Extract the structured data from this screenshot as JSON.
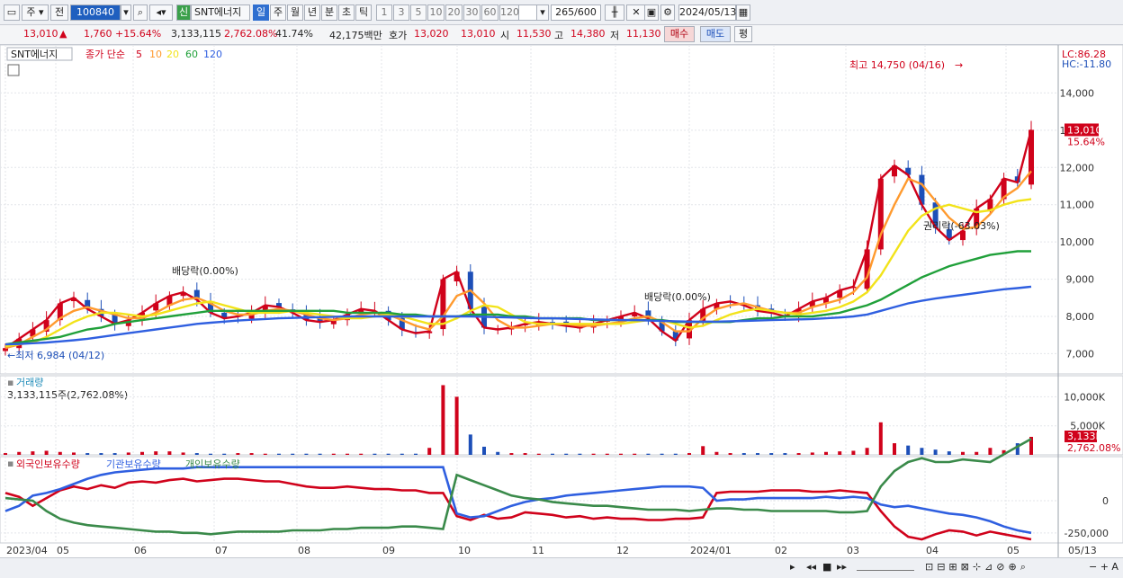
{
  "toolbar": {
    "type_label": "주",
    "prev_label": "전",
    "code": "100840",
    "badge": "신",
    "stock_name": "SNT에너지",
    "periods": [
      "일",
      "주",
      "월",
      "년",
      "분",
      "초",
      "틱"
    ],
    "active_period": "일",
    "intervals": [
      "1",
      "3",
      "5",
      "10",
      "20",
      "30",
      "60",
      "120"
    ],
    "count": "265",
    "count_max": "/600",
    "date": "2024/05/13"
  },
  "quote": {
    "price": "13,010",
    "change": "1,760",
    "change_pct": "+15.64%",
    "volume": "3,133,115",
    "volume_ratio": "2,762.08%",
    "turnover_rate": "41.74%",
    "amount": "42,175백만",
    "ask_label": "호가",
    "ask": "13,020",
    "bid": "13,010",
    "open_label": "시",
    "open": "11,530",
    "high_label": "고",
    "high": "14,380",
    "low_label": "저",
    "low": "11,130",
    "buy_label": "매수",
    "sell_label": "매도",
    "avg_label": "평"
  },
  "colors": {
    "up": "#d0021b",
    "down": "#1d4fb8",
    "ma5": "#d0021b",
    "ma10": "#ff9a2e",
    "ma20": "#f2e31a",
    "ma60": "#20a03a",
    "ma120": "#2f5fe0"
  },
  "chart_data": {
    "type": "line",
    "price": {
      "title": "SNT에너지",
      "legend": [
        "종가 단순",
        "5",
        "10",
        "20",
        "60",
        "120"
      ],
      "ylim": [
        6600,
        15000
      ],
      "y_ticks": [
        "7,000",
        "8,000",
        "9,000",
        "10,000",
        "11,000",
        "12,000",
        "13,000",
        "14,000"
      ],
      "y_tick_values": [
        7000,
        8000,
        9000,
        10000,
        11000,
        12000,
        13000,
        14000
      ],
      "x_ticks": [
        "2023/04",
        "05",
        "06",
        "07",
        "08",
        "09",
        "10",
        "11",
        "12",
        "2024/01",
        "02",
        "03",
        "04",
        "05",
        "05/13"
      ],
      "lc": "LC:86.28",
      "hc": "HC:-11.80",
      "last_price": "13,010",
      "last_pct": "15.64%",
      "annotations": {
        "high": "최고 14,750 (04/16)",
        "low": "최저 6,984 (04/12)",
        "div1": "배당락(0.00%)",
        "div2": "배당락(0.00%)",
        "rights": "권리락(-63.03%)"
      },
      "series": [
        {
          "name": "5",
          "values": [
            7150,
            7400,
            7650,
            7900,
            8350,
            8500,
            8200,
            8000,
            7800,
            7900,
            8100,
            8350,
            8550,
            8650,
            8450,
            8100,
            7950,
            8000,
            8100,
            8300,
            8250,
            8100,
            7900,
            7850,
            7900,
            8050,
            8200,
            8150,
            7900,
            7650,
            7550,
            7600,
            9000,
            9200,
            8200,
            7700,
            7650,
            7700,
            7800,
            7850,
            7800,
            7750,
            7700,
            7800,
            7900,
            8000,
            8100,
            7950,
            7600,
            7350,
            7900,
            8200,
            8350,
            8400,
            8300,
            8150,
            8100,
            8000,
            8200,
            8400,
            8500,
            8700,
            8800,
            9800,
            11700,
            12050,
            11800,
            11000,
            10400,
            10050,
            10300,
            10900,
            11150,
            11700,
            11600,
            13010
          ]
        },
        {
          "name": "10",
          "values": [
            7150,
            7250,
            7450,
            7650,
            7950,
            8150,
            8250,
            8150,
            8050,
            7950,
            7950,
            8100,
            8300,
            8450,
            8500,
            8350,
            8150,
            8050,
            8050,
            8150,
            8200,
            8150,
            8050,
            7950,
            7900,
            7950,
            8050,
            8100,
            8050,
            7900,
            7750,
            7650,
            8000,
            8550,
            8700,
            8350,
            7900,
            7700,
            7700,
            7750,
            7800,
            7800,
            7750,
            7750,
            7800,
            7850,
            7950,
            8000,
            7850,
            7600,
            7600,
            7950,
            8200,
            8300,
            8350,
            8250,
            8150,
            8100,
            8100,
            8250,
            8350,
            8450,
            8650,
            9050,
            10200,
            11000,
            11700,
            11550,
            11100,
            10650,
            10350,
            10400,
            10750,
            11200,
            11450,
            11900
          ]
        },
        {
          "name": "20",
          "values": [
            7200,
            7250,
            7300,
            7450,
            7650,
            7850,
            8000,
            8100,
            8100,
            8050,
            8000,
            8050,
            8150,
            8250,
            8350,
            8400,
            8300,
            8200,
            8100,
            8100,
            8100,
            8150,
            8100,
            8050,
            8000,
            7950,
            7950,
            8000,
            8050,
            8000,
            7900,
            7800,
            7800,
            7950,
            8150,
            8300,
            8250,
            8050,
            7850,
            7800,
            7800,
            7800,
            7800,
            7800,
            7800,
            7800,
            7850,
            7900,
            7900,
            7800,
            7700,
            7750,
            7900,
            8050,
            8150,
            8200,
            8150,
            8100,
            8050,
            8100,
            8150,
            8250,
            8400,
            8650,
            9100,
            9700,
            10300,
            10700,
            10900,
            11000,
            10900,
            10800,
            10850,
            11000,
            11100,
            11150
          ]
        },
        {
          "name": "60",
          "values": [
            7250,
            7300,
            7350,
            7400,
            7450,
            7550,
            7650,
            7700,
            7800,
            7850,
            7900,
            7950,
            8000,
            8050,
            8100,
            8150,
            8150,
            8150,
            8150,
            8150,
            8150,
            8150,
            8150,
            8150,
            8150,
            8100,
            8100,
            8100,
            8100,
            8050,
            8050,
            8000,
            8000,
            8000,
            8050,
            8050,
            8050,
            8000,
            8000,
            7950,
            7950,
            7950,
            7950,
            7900,
            7900,
            7900,
            7900,
            7900,
            7900,
            7850,
            7850,
            7850,
            7850,
            7850,
            7900,
            7950,
            7950,
            8000,
            8000,
            8000,
            8050,
            8100,
            8200,
            8300,
            8450,
            8650,
            8850,
            9050,
            9200,
            9350,
            9450,
            9550,
            9650,
            9700,
            9750,
            9750
          ]
        },
        {
          "name": "120",
          "values": [
            7250,
            7260,
            7280,
            7300,
            7330,
            7360,
            7400,
            7450,
            7500,
            7550,
            7600,
            7650,
            7700,
            7750,
            7800,
            7830,
            7860,
            7890,
            7910,
            7930,
            7950,
            7960,
            7970,
            7980,
            7990,
            8000,
            8000,
            8000,
            8000,
            8000,
            8000,
            8000,
            8000,
            8000,
            8000,
            7990,
            7980,
            7970,
            7960,
            7950,
            7950,
            7940,
            7930,
            7920,
            7910,
            7900,
            7900,
            7890,
            7880,
            7870,
            7860,
            7860,
            7860,
            7870,
            7880,
            7890,
            7900,
            7910,
            7920,
            7930,
            7950,
            7970,
            8000,
            8050,
            8150,
            8250,
            8350,
            8420,
            8480,
            8530,
            8580,
            8630,
            8680,
            8730,
            8760,
            8800
          ]
        }
      ]
    },
    "volume": {
      "title": "거래량",
      "value_label": "3,133,115주(2,762.08%)",
      "ylim": [
        0,
        13000000
      ],
      "y_ticks": [
        "5,000K",
        "10,000K"
      ],
      "y_tick_values": [
        5000000,
        10000000
      ],
      "last_label": "3,133K",
      "last_pct": "2,762.08%",
      "values": [
        0.3,
        0.5,
        0.6,
        0.7,
        0.5,
        0.4,
        0.3,
        0.3,
        0.3,
        0.4,
        0.5,
        0.6,
        0.6,
        0.4,
        0.3,
        0.2,
        0.2,
        0.3,
        0.3,
        0.2,
        0.2,
        0.2,
        0.2,
        0.2,
        0.2,
        0.2,
        0.2,
        0.2,
        0.2,
        0.2,
        0.2,
        1.2,
        12.0,
        10.0,
        3.5,
        1.4,
        0.5,
        0.3,
        0.3,
        0.2,
        0.2,
        0.2,
        0.2,
        0.2,
        0.2,
        0.2,
        0.2,
        0.2,
        0.2,
        0.2,
        0.3,
        1.5,
        0.5,
        0.3,
        0.3,
        0.3,
        0.3,
        0.3,
        0.3,
        0.4,
        0.5,
        0.6,
        0.7,
        1.2,
        5.6,
        2.0,
        1.6,
        1.2,
        0.9,
        0.6,
        0.5,
        0.5,
        1.2,
        0.8,
        2.0,
        3.1
      ]
    },
    "holdings": {
      "legend": [
        "외국인보유수량",
        "기관보유수량",
        "개인보유수량"
      ],
      "ylim": [
        -300000,
        300000
      ],
      "y_ticks": [
        "0",
        "-250,000"
      ],
      "y_tick_values": [
        0,
        -250000
      ],
      "series": [
        {
          "name": "외국인보유수량",
          "values": [
            60000,
            30000,
            -40000,
            20000,
            80000,
            110000,
            90000,
            120000,
            100000,
            140000,
            150000,
            140000,
            160000,
            170000,
            150000,
            160000,
            170000,
            170000,
            160000,
            150000,
            150000,
            130000,
            110000,
            100000,
            100000,
            110000,
            100000,
            90000,
            90000,
            80000,
            80000,
            60000,
            60000,
            -120000,
            -150000,
            -110000,
            -140000,
            -130000,
            -90000,
            -100000,
            -110000,
            -130000,
            -120000,
            -140000,
            -130000,
            -140000,
            -140000,
            -150000,
            -150000,
            -140000,
            -140000,
            -130000,
            60000,
            70000,
            70000,
            70000,
            80000,
            80000,
            80000,
            70000,
            70000,
            80000,
            70000,
            60000,
            -80000,
            -200000,
            -280000,
            -300000,
            -260000,
            -230000,
            -240000,
            -270000,
            -240000,
            -260000,
            -280000,
            -300000
          ]
        },
        {
          "name": "기관보유수량",
          "values": [
            -80000,
            -40000,
            40000,
            60000,
            90000,
            130000,
            170000,
            200000,
            220000,
            230000,
            240000,
            250000,
            250000,
            250000,
            260000,
            260000,
            260000,
            260000,
            260000,
            260000,
            260000,
            260000,
            260000,
            260000,
            260000,
            260000,
            260000,
            260000,
            260000,
            260000,
            260000,
            260000,
            260000,
            -100000,
            -130000,
            -120000,
            -80000,
            -40000,
            -10000,
            10000,
            20000,
            40000,
            50000,
            60000,
            70000,
            80000,
            90000,
            100000,
            110000,
            110000,
            110000,
            100000,
            0,
            10000,
            10000,
            20000,
            20000,
            20000,
            20000,
            20000,
            30000,
            20000,
            30000,
            20000,
            -30000,
            -50000,
            -40000,
            -60000,
            -80000,
            -100000,
            -110000,
            -130000,
            -160000,
            -200000,
            -230000,
            -250000
          ]
        },
        {
          "name": "개인보유수량",
          "values": [
            20000,
            10000,
            0,
            -80000,
            -140000,
            -170000,
            -190000,
            -200000,
            -210000,
            -220000,
            -230000,
            -240000,
            -240000,
            -250000,
            -250000,
            -260000,
            -250000,
            -240000,
            -240000,
            -240000,
            -240000,
            -230000,
            -230000,
            -230000,
            -220000,
            -220000,
            -210000,
            -210000,
            -210000,
            -200000,
            -200000,
            -210000,
            -220000,
            200000,
            160000,
            120000,
            80000,
            40000,
            20000,
            10000,
            -10000,
            -20000,
            -30000,
            -40000,
            -40000,
            -50000,
            -60000,
            -70000,
            -70000,
            -70000,
            -80000,
            -70000,
            -60000,
            -60000,
            -70000,
            -70000,
            -80000,
            -80000,
            -80000,
            -80000,
            -80000,
            -90000,
            -90000,
            -80000,
            110000,
            230000,
            300000,
            330000,
            300000,
            300000,
            320000,
            310000,
            300000,
            360000,
            420000,
            480000
          ]
        }
      ]
    }
  },
  "bottom": {
    "icons": [
      "scroll-right-icon",
      "prev-icon",
      "stop-icon",
      "next-icon",
      "zoom-slider-icon",
      "tool-icons"
    ],
    "zoom_label": "− + A"
  }
}
